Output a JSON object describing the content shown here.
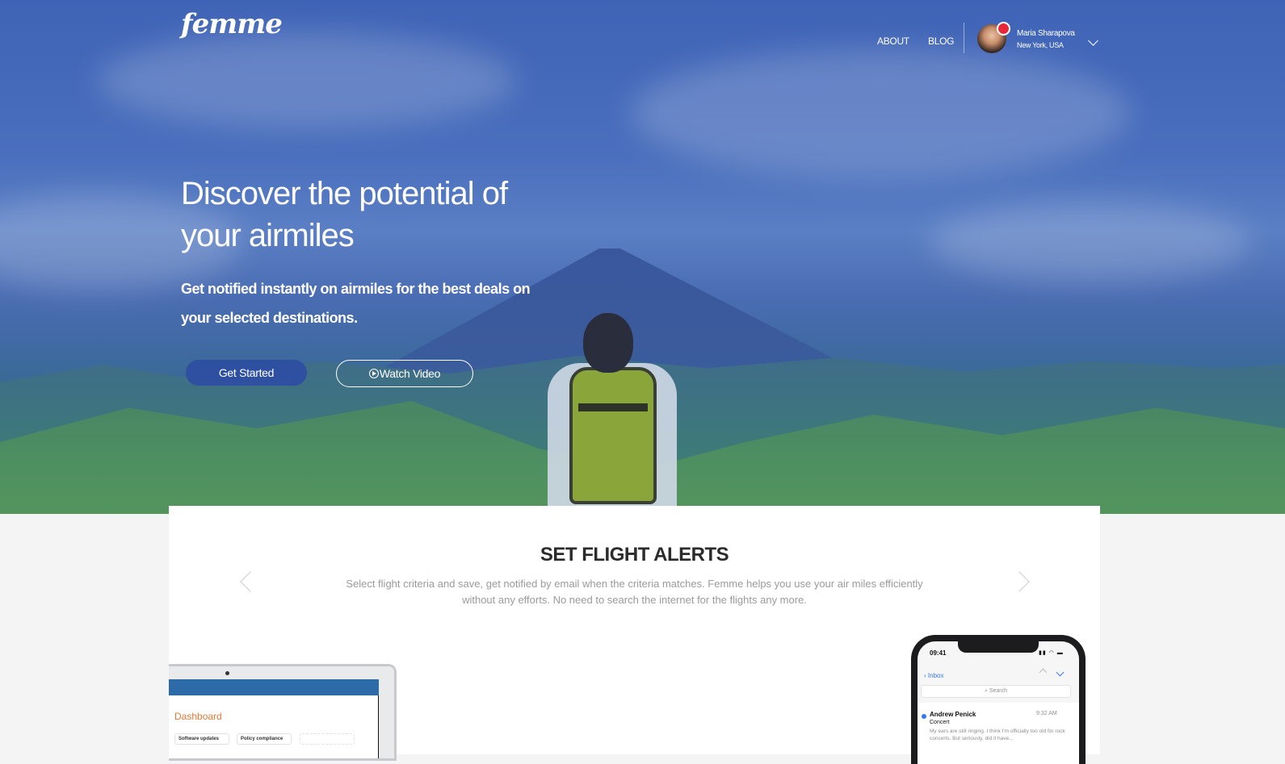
{
  "brand": {
    "logo_text": "femme"
  },
  "nav": {
    "links": [
      {
        "label": "ABOUT"
      },
      {
        "label": "BLOG"
      }
    ],
    "user": {
      "name": "Maria Sharapova",
      "location": "New York, USA"
    }
  },
  "hero": {
    "headline": "Discover the potential of your airmiles",
    "subhead": "Get notified instantly on airmiles for the best deals on your selected destinations.",
    "primary_button": "Get Started",
    "secondary_button": "Watch Video"
  },
  "features": {
    "title": "SET FLIGHT ALERTS",
    "description": "Select flight criteria and save, get notified by email when the criteria matches. Femme helps you use your air miles efficiently without any efforts. No need to search the internet for the flights any more."
  },
  "laptop_mock": {
    "heading": "Dashboard",
    "cards": [
      "Software updates",
      "Policy compliance"
    ]
  },
  "phone_mock": {
    "time": "09:41",
    "back_label": "Inbox",
    "search_placeholder": "Search",
    "mail": {
      "sender": "Andrew Penick",
      "time": "9:32 AM",
      "subject": "Concert",
      "preview": "My ears are still ringing. I think I'm officially too old for rock concerts. But seriously, did it have..."
    }
  },
  "colors": {
    "primary": "#2f4fa0",
    "notification": "#e8283a",
    "hero_overlay": "#4a6fbd"
  }
}
